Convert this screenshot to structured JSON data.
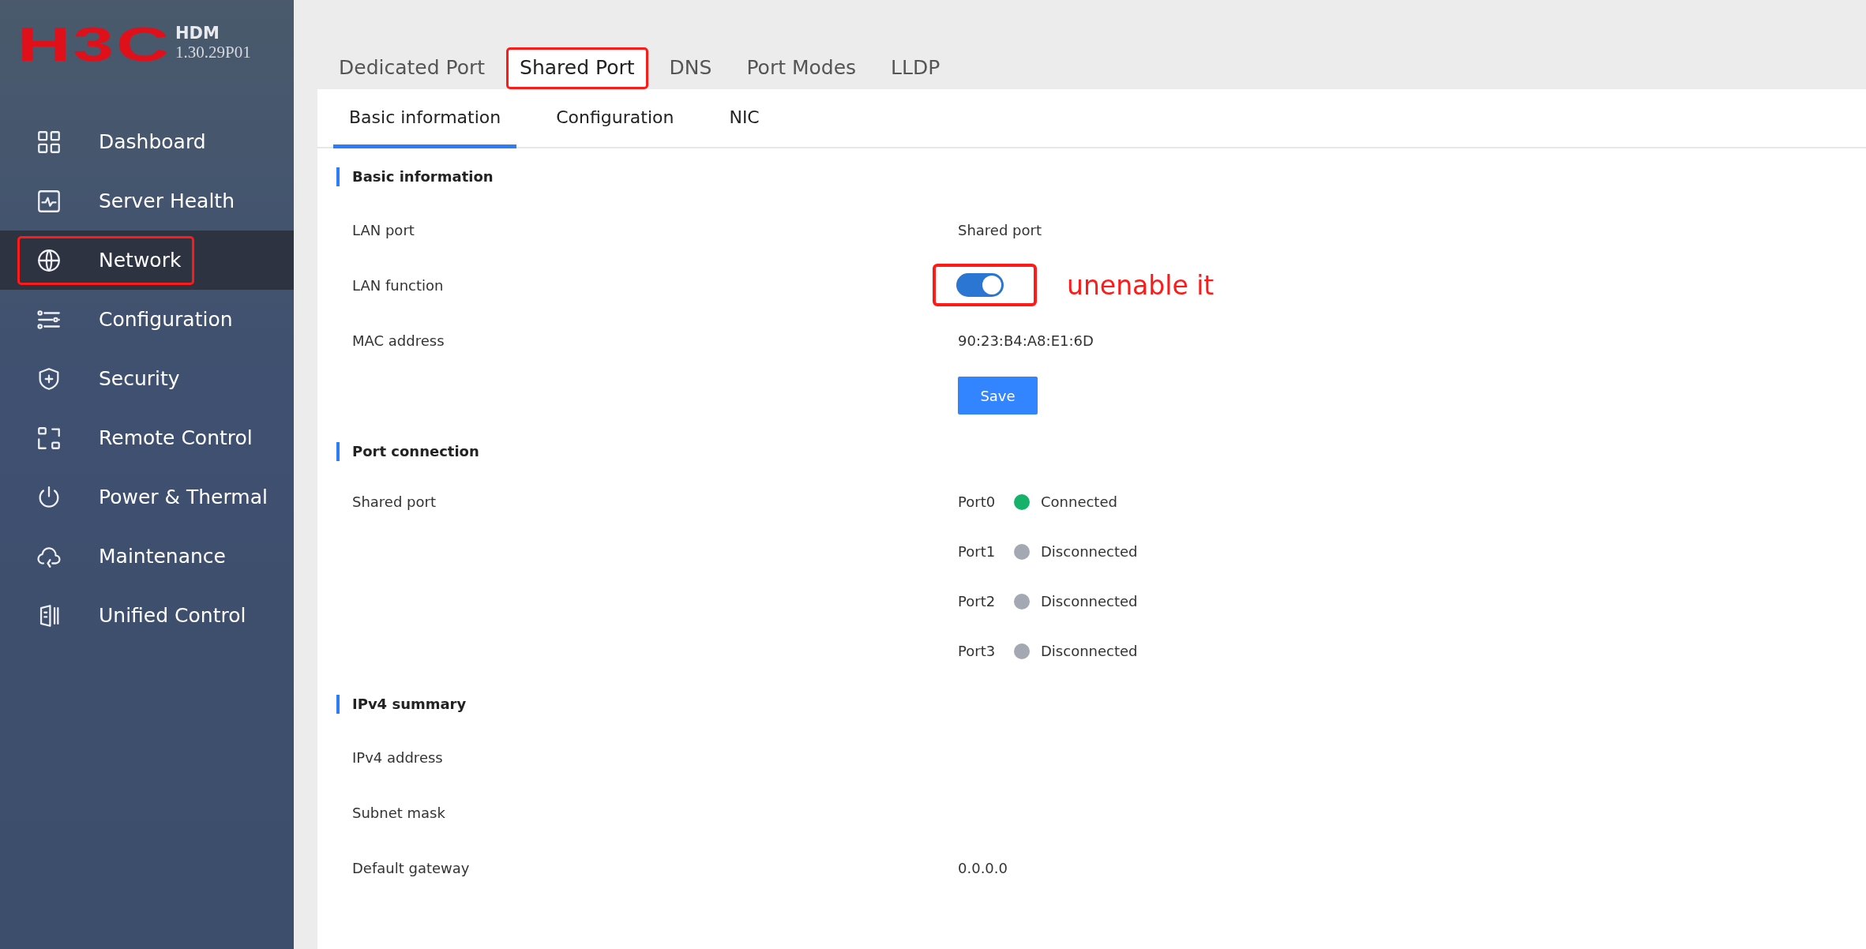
{
  "logo": {
    "brand": "H3C",
    "product": "HDM",
    "version": "1.30.29P01"
  },
  "sidebar": {
    "items": [
      {
        "label": "Dashboard",
        "selected": false,
        "outlined": false
      },
      {
        "label": "Server Health",
        "selected": false,
        "outlined": false
      },
      {
        "label": "Network",
        "selected": true,
        "outlined": true
      },
      {
        "label": "Configuration",
        "selected": false,
        "outlined": false
      },
      {
        "label": "Security",
        "selected": false,
        "outlined": false
      },
      {
        "label": "Remote Control",
        "selected": false,
        "outlined": false
      },
      {
        "label": "Power & Thermal",
        "selected": false,
        "outlined": false
      },
      {
        "label": "Maintenance",
        "selected": false,
        "outlined": false
      },
      {
        "label": "Unified Control",
        "selected": false,
        "outlined": false
      }
    ]
  },
  "tabs": [
    {
      "label": "Dedicated Port",
      "selected": false,
      "outlined": false
    },
    {
      "label": "Shared Port",
      "selected": true,
      "outlined": true
    },
    {
      "label": "DNS",
      "selected": false,
      "outlined": false
    },
    {
      "label": "Port Modes",
      "selected": false,
      "outlined": false
    },
    {
      "label": "LLDP",
      "selected": false,
      "outlined": false
    }
  ],
  "subtabs": [
    {
      "label": "Basic information",
      "selected": true
    },
    {
      "label": "Configuration",
      "selected": false
    },
    {
      "label": "NIC",
      "selected": false
    }
  ],
  "sections": [
    {
      "title": "Basic information",
      "rows": [
        {
          "kind": "text",
          "label": "LAN port",
          "value": "Shared port"
        },
        {
          "kind": "toggle",
          "label": "LAN function",
          "on": true,
          "outlined": true,
          "note": "unenable it"
        },
        {
          "kind": "text",
          "label": "MAC address",
          "value": "90:23:B4:A8:E1:6D"
        },
        {
          "kind": "button",
          "label": "Save"
        }
      ]
    },
    {
      "title": "Port connection",
      "rows": [
        {
          "kind": "ports",
          "label": "Shared port",
          "ports": [
            {
              "name": "Port0",
              "status": "Connected",
              "color": "#17b26a"
            },
            {
              "name": "Port1",
              "status": "Disconnected",
              "color": "#a3a8b2"
            },
            {
              "name": "Port2",
              "status": "Disconnected",
              "color": "#a3a8b2"
            },
            {
              "name": "Port3",
              "status": "Disconnected",
              "color": "#a3a8b2"
            }
          ]
        }
      ]
    },
    {
      "title": "IPv4 summary",
      "rows": [
        {
          "kind": "text",
          "label": "IPv4 address"
        },
        {
          "kind": "text",
          "label": "Subnet mask"
        },
        {
          "kind": "text",
          "label": "Default gateway",
          "value": "0.0.0.0"
        }
      ]
    }
  ]
}
